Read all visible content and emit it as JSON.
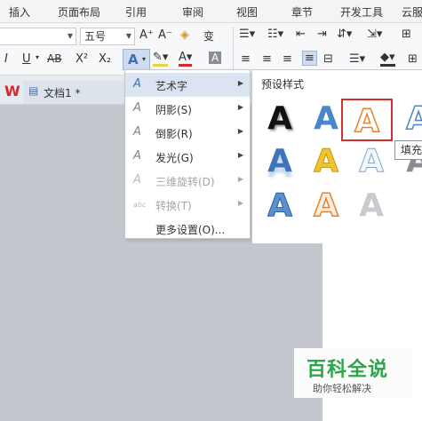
{
  "menu_tabs": [
    "插入",
    "页面布局",
    "引用",
    "审阅",
    "视图",
    "章节",
    "开发工具",
    "云服"
  ],
  "ribbon": {
    "font_size_value": "五号",
    "grow_font_label": "A⁺",
    "shrink_font_label": "A⁻",
    "italic_label": "I",
    "underline_label": "U",
    "strike_label": "AB",
    "superscript_label": "X²",
    "subscript_label": "X₂",
    "wordart_label": "A",
    "font_color_label": "A",
    "char_shading_label": "A",
    "phonetic_label": "变",
    "clear_format_label": "◈"
  },
  "doc_tabs": {
    "logo": "W",
    "doc_title": "文档1 *"
  },
  "dropdown_menu": {
    "items": [
      {
        "label": "艺术字",
        "icon": "wordart-icon",
        "has_submenu": true,
        "active": true,
        "disabled": false
      },
      {
        "label": "阴影(S)",
        "icon": "shadow-icon",
        "has_submenu": true,
        "active": false,
        "disabled": false
      },
      {
        "label": "倒影(R)",
        "icon": "reflection-icon",
        "has_submenu": true,
        "active": false,
        "disabled": false
      },
      {
        "label": "发光(G)",
        "icon": "glow-icon",
        "has_submenu": true,
        "active": false,
        "disabled": false
      },
      {
        "label": "三维旋转(D)",
        "icon": "3d-rotation-icon",
        "has_submenu": true,
        "active": false,
        "disabled": true
      },
      {
        "label": "转换(T)",
        "icon": "transform-icon",
        "has_submenu": true,
        "active": false,
        "disabled": true
      },
      {
        "label": "更多设置(O)...",
        "icon": "",
        "has_submenu": false,
        "active": false,
        "disabled": false
      }
    ]
  },
  "submenu": {
    "title": "预设样式",
    "presets": [
      {
        "letter": "A",
        "style": "black-shadow"
      },
      {
        "letter": "A",
        "style": "blue-gradient"
      },
      {
        "letter": "A",
        "style": "orange-outline",
        "selected": true
      },
      {
        "letter": "A",
        "style": "blue-outline-partial"
      },
      {
        "letter": "A",
        "style": "blue-reflection"
      },
      {
        "letter": "A",
        "style": "gold-gradient"
      },
      {
        "letter": "A",
        "style": "light-blue-outline"
      },
      {
        "letter": "A",
        "style": "gray-partial"
      },
      {
        "letter": "A",
        "style": "blue-bevel"
      },
      {
        "letter": "A",
        "style": "orange-outline-2"
      },
      {
        "letter": "A",
        "style": "silver-gradient"
      }
    ],
    "tooltip": "填充"
  },
  "watermark": {
    "title": "百科全说",
    "subtitle": "助你轻松解决"
  }
}
